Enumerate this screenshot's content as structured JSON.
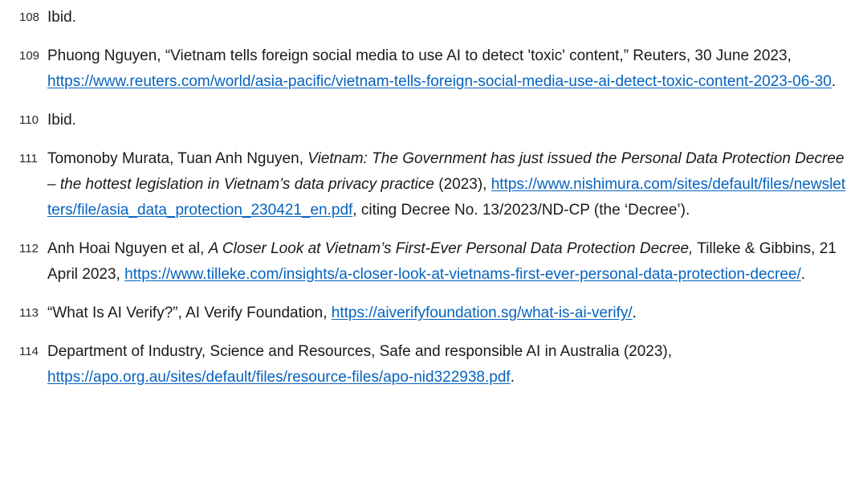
{
  "footnotes": [
    {
      "num": "108",
      "parts": [
        {
          "type": "text",
          "text": "Ibid."
        }
      ]
    },
    {
      "num": "109",
      "parts": [
        {
          "type": "text",
          "text": "Phuong Nguyen, “Vietnam tells foreign social media to use AI to detect 'toxic' content,” Reuters, 30 June 2023, "
        },
        {
          "type": "link",
          "text": "https://www.reuters.com/world/asia-pacific/vietnam-tells-foreign-social-media-use-ai-detect-toxic-content-2023-06-30"
        },
        {
          "type": "text",
          "text": "."
        }
      ]
    },
    {
      "num": "110",
      "parts": [
        {
          "type": "text",
          "text": "Ibid."
        }
      ]
    },
    {
      "num": "111",
      "parts": [
        {
          "type": "text",
          "text": "Tomonoby Murata, Tuan Anh Nguyen, "
        },
        {
          "type": "italic",
          "text": "Vietnam: The Government has just issued the Personal Data Protection Decree – the hottest legislation in Vietnam’s data privacy practice"
        },
        {
          "type": "text",
          "text": " (2023), "
        },
        {
          "type": "link",
          "text": "https://www.nishimura.com/sites/default/files/newsletters/file/asia_data_protection_230421_en.pdf",
          "break_all": true
        },
        {
          "type": "text",
          "text": ", citing Decree No. 13/2023/ND-CP (the ‘Decree’)."
        }
      ]
    },
    {
      "num": "112",
      "parts": [
        {
          "type": "text",
          "text": "Anh Hoai Nguyen et al, "
        },
        {
          "type": "italic",
          "text": "A Closer Look at Vietnam’s First-Ever Personal Data Protection Decree,"
        },
        {
          "type": "text",
          "text": " Tilleke & Gibbins, 21 April 2023, "
        },
        {
          "type": "link",
          "text": "https://www.tilleke.com/insights/a-closer-look-at-vietnams-first-ever-personal-data-protection-decree/"
        },
        {
          "type": "text",
          "text": "."
        }
      ]
    },
    {
      "num": "113",
      "parts": [
        {
          "type": "text",
          "text": "“What Is AI Verify?”, AI Verify Foundation, "
        },
        {
          "type": "link",
          "text": "https://aiverifyfoundation.sg/what-is-ai-verify/"
        },
        {
          "type": "text",
          "text": "."
        }
      ]
    },
    {
      "num": "114",
      "parts": [
        {
          "type": "text",
          "text": "Department of Industry, Science and Resources, Safe and responsible AI in Australia (2023), "
        },
        {
          "type": "link",
          "text": "https://apo.org.au/sites/default/files/resource-files/apo-nid322938.pdf"
        },
        {
          "type": "text",
          "text": "."
        }
      ]
    }
  ]
}
